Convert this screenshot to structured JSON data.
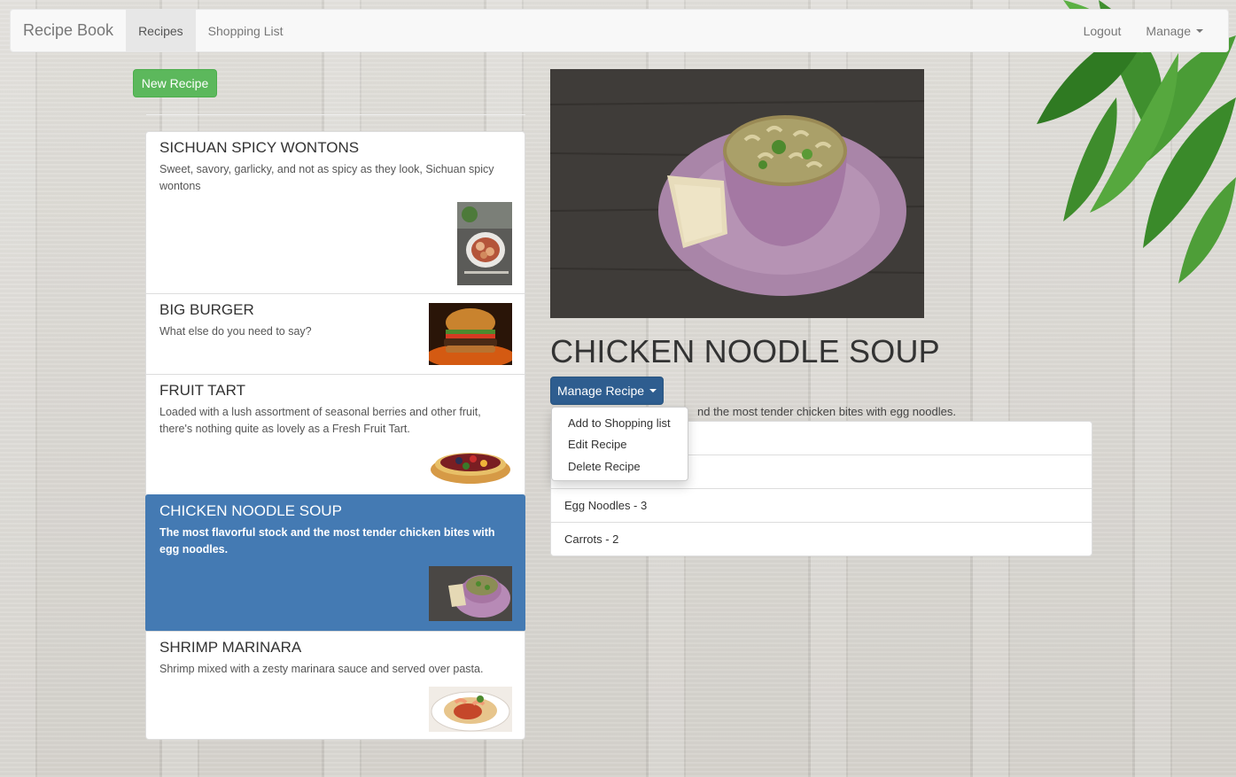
{
  "navbar": {
    "brand": "Recipe Book",
    "links": [
      "Recipes",
      "Shopping List"
    ],
    "logout": "Logout",
    "manage": "Manage"
  },
  "sidebar": {
    "new_button": "New Recipe",
    "recipes": [
      {
        "name": "SICHUAN SPICY WONTONS",
        "description": "Sweet, savory, garlicky, and not as spicy as they look, Sichuan spicy wontons"
      },
      {
        "name": "BIG BURGER",
        "description": "What else do you need to say?"
      },
      {
        "name": "FRUIT TART",
        "description": "Loaded with a lush assortment of seasonal berries and other fruit, there's nothing quite as lovely as a Fresh Fruit Tart."
      },
      {
        "name": "CHICKEN NOODLE SOUP",
        "description": "The most flavorful stock and the most tender chicken bites with egg noodles."
      },
      {
        "name": "SHRIMP MARINARA",
        "description": "Shrimp mixed with a zesty marinara sauce and served over pasta."
      }
    ]
  },
  "detail": {
    "title": "CHICKEN NOODLE SOUP",
    "manage_button": "Manage Recipe",
    "visible_description": "nd the most tender chicken bites with egg noodles.",
    "ingredients": [
      "",
      "",
      "Egg Noodles - 3",
      "Carrots - 2"
    ],
    "dropdown": [
      "Add to Shopping list",
      "Edit Recipe",
      "Delete Recipe"
    ]
  },
  "colors": {
    "primary": "#447ab3",
    "success": "#5cb85c",
    "manage_button": "#2e5d8f"
  }
}
